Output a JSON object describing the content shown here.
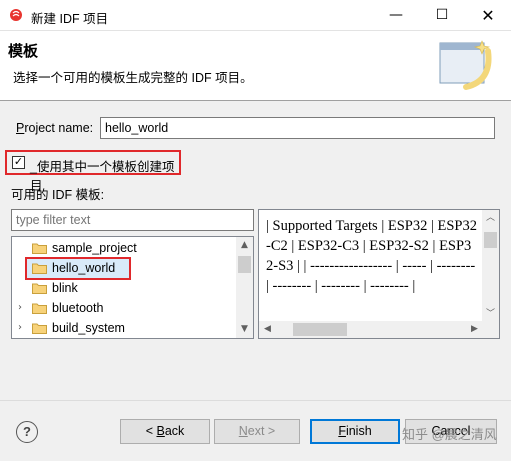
{
  "window": {
    "title": "新建 IDF 项目",
    "minimize_glyph": "—",
    "maximize_glyph": "☐",
    "close_glyph": "✕"
  },
  "header": {
    "title": "模板",
    "description": "选择一个可用的模板生成完整的 IDF 项目。"
  },
  "form": {
    "project_name_label_mnemonic": "P",
    "project_name_label_rest": "roject name:",
    "project_name_value": "hello_world",
    "use_template_label": "_使用其中一个模板创建项目",
    "use_template_checked": true,
    "available_templates_label": "可用的 IDF 模板:",
    "filter_placeholder": "type filter text"
  },
  "tree": {
    "items": [
      {
        "label": "sample_project",
        "expandable": false,
        "selected": false
      },
      {
        "label": "hello_world",
        "expandable": false,
        "selected": true
      },
      {
        "label": "blink",
        "expandable": false,
        "selected": false
      },
      {
        "label": "bluetooth",
        "expandable": true,
        "selected": false
      },
      {
        "label": "build_system",
        "expandable": true,
        "selected": false
      }
    ]
  },
  "description": {
    "text": "| Supported Targets | ESP32 | ESP32-C2 | ESP32-C3 | ESP32-S2 | ESP32-S3 | | ----------------- | ----- | -------- | -------- | -------- | -------- |"
  },
  "buttons": {
    "help": "?",
    "back_prefix": "< ",
    "back_mnemonic": "B",
    "back_rest": "ack",
    "next_mnemonic": "N",
    "next_rest": "ext >",
    "finish_mnemonic": "F",
    "finish_rest": "inish",
    "cancel": "Cancel"
  },
  "watermark": "知乎 @晨之清风",
  "colors": {
    "highlight_red": "#e0282b",
    "selection_blue": "#d9eaf9",
    "default_button_border": "#0078d7"
  },
  "icons": {
    "app": "esp-idf-icon",
    "banner": "wizard-banner-icon",
    "folder": "folder-icon"
  }
}
